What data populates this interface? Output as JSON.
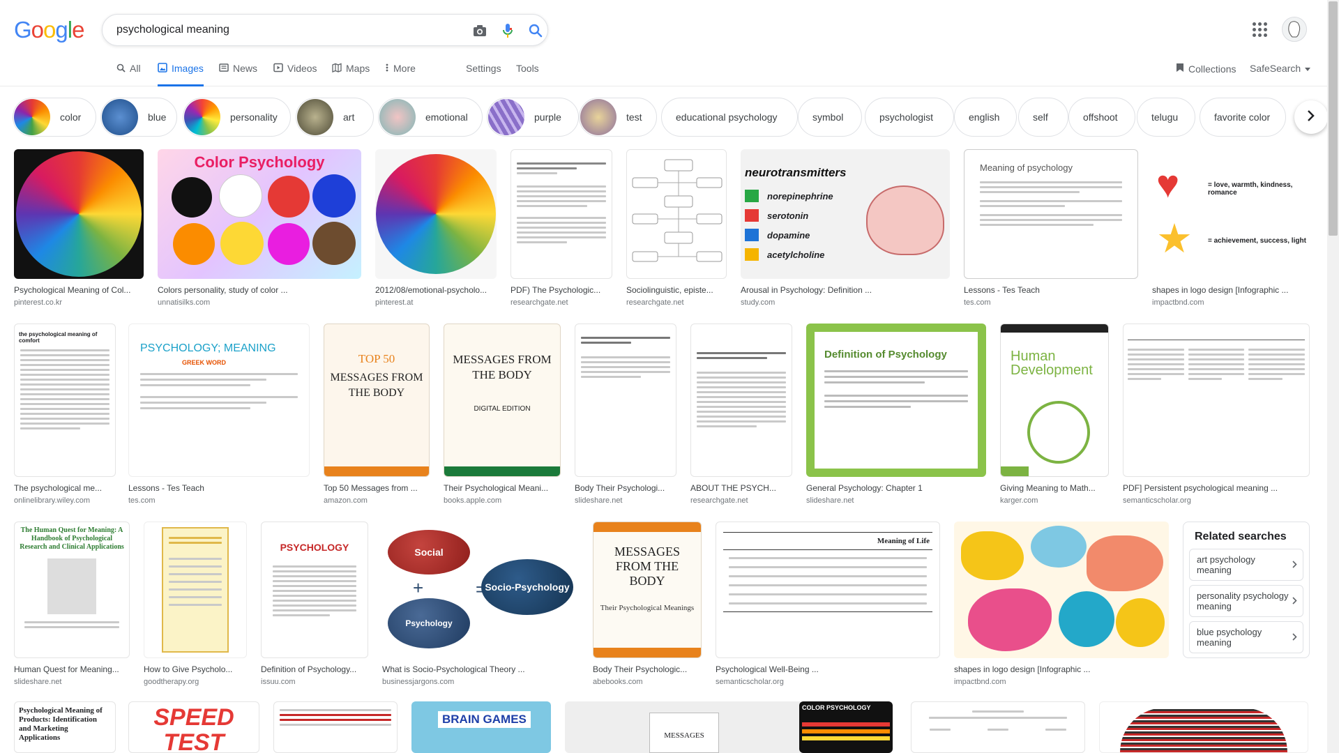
{
  "brand": {
    "logo": "Google"
  },
  "search": {
    "query": "psychological meaning"
  },
  "tabs": [
    {
      "label": "All",
      "icon": "search-icon"
    },
    {
      "label": "Images",
      "icon": "image-icon",
      "active": true
    },
    {
      "label": "News",
      "icon": "news-icon"
    },
    {
      "label": "Videos",
      "icon": "video-icon"
    },
    {
      "label": "Maps",
      "icon": "map-icon"
    },
    {
      "label": "More",
      "icon": "more-vert-icon"
    }
  ],
  "tools": {
    "settings": "Settings",
    "tools": "Tools",
    "collections": "Collections",
    "safesearch": "SafeSearch"
  },
  "chips": [
    {
      "label": "color"
    },
    {
      "label": "blue"
    },
    {
      "label": "personality"
    },
    {
      "label": "art"
    },
    {
      "label": "emotional"
    },
    {
      "label": "purple"
    },
    {
      "label": "test"
    },
    {
      "label": "educational psychology"
    },
    {
      "label": "symbol"
    },
    {
      "label": "psychologist"
    },
    {
      "label": "english"
    },
    {
      "label": "self"
    },
    {
      "label": "offshoot"
    },
    {
      "label": "telugu"
    },
    {
      "label": "favorite color"
    }
  ],
  "results": [
    {
      "caption": "Psychological Meaning of Col...",
      "source": "pinterest.co.kr"
    },
    {
      "caption": "Colors personality, study of color ...",
      "source": "unnatisilks.com",
      "img_title": "Color Psychology"
    },
    {
      "caption": "2012/08/emotional-psycholo...",
      "source": "pinterest.at"
    },
    {
      "caption": "PDF) The Psychologic...",
      "source": "researchgate.net"
    },
    {
      "caption": "Sociolinguistic, episte...",
      "source": "researchgate.net"
    },
    {
      "caption": "Arousal in Psychology: Definition ...",
      "source": "study.com",
      "img_title": "neurotransmitters",
      "img_items": [
        "norepinephrine",
        "serotonin",
        "dopamine",
        "acetylcholine"
      ]
    },
    {
      "caption": "Lessons - Tes Teach",
      "source": "tes.com",
      "img_title": "Meaning of psychology"
    },
    {
      "caption": "shapes in logo design [Infographic ...",
      "source": "impactbnd.com",
      "img_items": [
        "= love, warmth, kindness, romance",
        "= achievement, success, light"
      ]
    },
    {
      "caption": "The psychological me...",
      "source": "onlinelibrary.wiley.com",
      "img_title": "the psychological meaning of comfort"
    },
    {
      "caption": "Lessons - Tes Teach",
      "source": "tes.com",
      "img_title": "PSYCHOLOGY; MEANING",
      "img_sub": "GREEK WORD"
    },
    {
      "caption": "Top 50 Messages from ...",
      "source": "amazon.com",
      "img_title": "TOP 50",
      "img_sub": "MESSAGES FROM THE BODY"
    },
    {
      "caption": "Their Psychological Meani...",
      "source": "books.apple.com",
      "img_title": "MESSAGES FROM THE BODY",
      "img_sub": "DIGITAL EDITION"
    },
    {
      "caption": "Body Their Psychologi...",
      "source": "slideshare.net"
    },
    {
      "caption": "ABOUT THE PSYCH...",
      "source": "researchgate.net"
    },
    {
      "caption": "General Psychology: Chapter 1",
      "source": "slideshare.net",
      "img_title": "Definition of Psychology"
    },
    {
      "caption": "Giving Meaning to Math...",
      "source": "karger.com",
      "img_title": "Human Development"
    },
    {
      "caption": "PDF] Persistent psychological meaning ...",
      "source": "semanticscholar.org"
    },
    {
      "caption": "Human Quest for Meaning...",
      "source": "slideshare.net",
      "img_title": "The Human Quest for Meaning: A Handbook of Psychological Research and Clinical Applications"
    },
    {
      "caption": "How to Give Psycholo...",
      "source": "goodtherapy.org"
    },
    {
      "caption": "Definition of Psychology...",
      "source": "issuu.com",
      "img_title": "PSYCHOLOGY"
    },
    {
      "caption": "What is Socio-Psychological Theory ...",
      "source": "businessjargons.com",
      "img_items": [
        "Social",
        "Psychology",
        "Socio-Psychology"
      ]
    },
    {
      "caption": "Body Their Psychologic...",
      "source": "abebooks.com",
      "img_title": "MESSAGES FROM THE BODY",
      "img_sub": "Their Psychological Meanings"
    },
    {
      "caption": "Psychological Well-Being ...",
      "source": "semanticscholar.org",
      "img_title": "Meaning of Life"
    },
    {
      "caption": "shapes in logo design [Infographic ...",
      "source": "impactbnd.com"
    },
    {
      "caption": "",
      "source": "",
      "img_title": "Psychological Meaning of Products: Identification and Marketing Applications"
    },
    {
      "caption": "",
      "source": "",
      "img_title": "SPEED TEST"
    },
    {
      "caption": "",
      "source": ""
    },
    {
      "caption": "",
      "source": "",
      "img_title": "BRAIN GAMES"
    },
    {
      "caption": "",
      "source": "",
      "img_title": "MESSAGES"
    },
    {
      "caption": "",
      "source": "",
      "img_title": "COLOR PSYCHOLOGY"
    },
    {
      "caption": "",
      "source": ""
    },
    {
      "caption": "",
      "source": ""
    }
  ],
  "related": {
    "title": "Related searches",
    "items": [
      "art psychology meaning",
      "personality psychology meaning",
      "blue psychology meaning"
    ]
  },
  "colors": {
    "blue": "#1a73e8",
    "red": "#ea4335",
    "yellow": "#fbbc05",
    "green": "#34a853"
  }
}
